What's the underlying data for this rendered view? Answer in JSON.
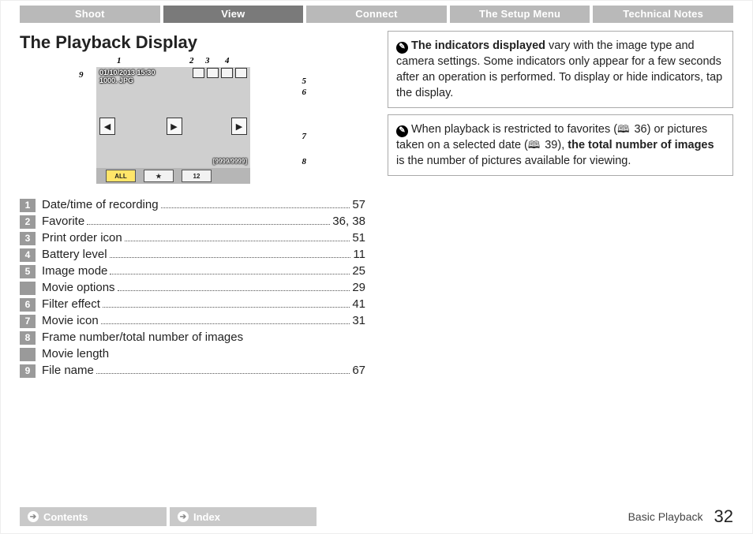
{
  "tabs": {
    "items": [
      "Shoot",
      "View",
      "Connect",
      "The Setup Menu",
      "Technical Notes"
    ],
    "active_index": 1
  },
  "heading": "The Playback Display",
  "figure": {
    "datetime": "01/10/2013  15:30",
    "filename": "1000. JPG",
    "frame_count": "[9999/9999]",
    "bottom_tabs": {
      "all": "ALL",
      "star": "★",
      "cal": "12"
    }
  },
  "callouts": {
    "c1": "1",
    "c2": "2",
    "c3": "3",
    "c4": "4",
    "c5": "5",
    "c6": "6",
    "c7": "7",
    "c8": "8",
    "c9": "9"
  },
  "index": [
    {
      "num": "1",
      "label": "Date/time of recording",
      "page": "57"
    },
    {
      "num": "2",
      "label": "Favorite",
      "page": "36, 38"
    },
    {
      "num": "3",
      "label": "Print order icon",
      "page": "51"
    },
    {
      "num": "4",
      "label": "Battery level",
      "page": "11"
    },
    {
      "num": "5",
      "label": "Image mode",
      "page": "25"
    },
    {
      "num": "",
      "label": "Movie options",
      "page": "29"
    },
    {
      "num": "6",
      "label": "Filter effect",
      "page": "41"
    },
    {
      "num": "7",
      "label": "Movie icon",
      "page": "31"
    },
    {
      "num": "8",
      "label": "Frame number/total number of images",
      "page": ""
    },
    {
      "num": "",
      "label": "Movie length",
      "page": ""
    },
    {
      "num": "9",
      "label": "File name",
      "page": "67"
    }
  ],
  "note1": {
    "lead_bold": "The indicators displayed",
    "body": " vary with the image type and camera settings. Some indicators only appear for a few seconds after an operation is performed. To display or hide indicators, tap the display."
  },
  "note2": {
    "pre": "When playback is restricted to favorites (",
    "ref1": " 36",
    "mid": ") or pictures taken on a selected date (",
    "ref2": " 39",
    "post1": "), ",
    "bold": "the total number of images",
    "post2": " is the number of pictures available for viewing."
  },
  "footer": {
    "contents": "Contents",
    "index": "Index",
    "section": "Basic Playback",
    "page": "32"
  }
}
